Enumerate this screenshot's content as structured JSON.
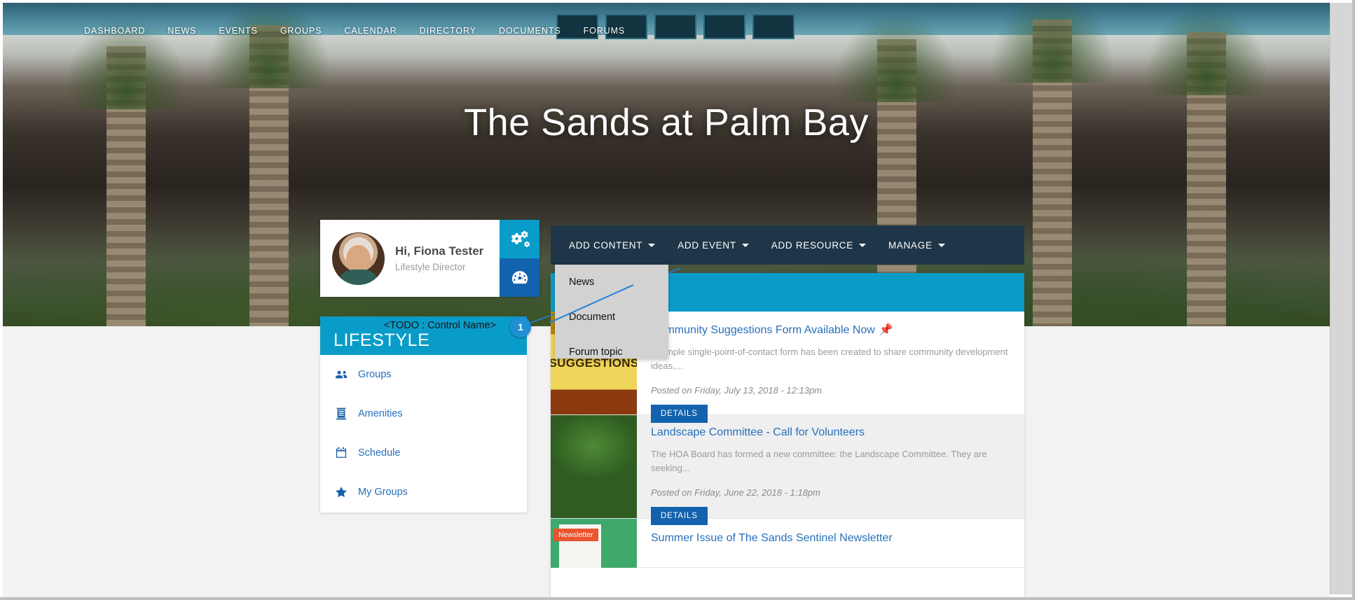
{
  "site": {
    "title": "The Sands at Palm Bay"
  },
  "top_nav": {
    "items": [
      {
        "label": "DASHBOARD"
      },
      {
        "label": "NEWS"
      },
      {
        "label": "EVENTS"
      },
      {
        "label": "GROUPS"
      },
      {
        "label": "CALENDAR"
      },
      {
        "label": "DIRECTORY"
      },
      {
        "label": "DOCUMENTS"
      },
      {
        "label": "FORUMS"
      }
    ]
  },
  "profile": {
    "greeting": "Hi, Fiona Tester",
    "role": "Lifestyle Director",
    "settings_icon": "gears-icon",
    "dashboard_icon": "speedometer-icon"
  },
  "lifestyle": {
    "title": "LIFESTYLE",
    "todo_note": "<TODO : Control Name>",
    "badge": "1",
    "header_color": "#0a9cc8",
    "items": [
      {
        "label": "Groups",
        "icon": "users-group-icon"
      },
      {
        "label": "Amenities",
        "icon": "building-icon"
      },
      {
        "label": "Schedule",
        "icon": "calendar-icon"
      },
      {
        "label": "My Groups",
        "icon": "star-icon"
      }
    ]
  },
  "admin_toolbar": {
    "background": "#1e3648",
    "buttons": [
      {
        "label": "ADD CONTENT",
        "has_caret": true,
        "expanded": true
      },
      {
        "label": "ADD EVENT",
        "has_caret": true,
        "expanded": false
      },
      {
        "label": "ADD RESOURCE",
        "has_caret": true,
        "expanded": false
      },
      {
        "label": "MANAGE",
        "has_caret": true,
        "expanded": false
      }
    ]
  },
  "add_content_menu": {
    "items": [
      {
        "label": "News"
      },
      {
        "label": "Document"
      },
      {
        "label": "Forum topic"
      }
    ]
  },
  "news_widget": {
    "header_color": "#0a9cc8",
    "details_label": "DETAILS",
    "items": [
      {
        "title": "Community Suggestions Form Available Now",
        "pinned": true,
        "pin_icon": "pin-icon",
        "summary": "A simple single-point-of-contact form has been created to share community development ideas,...",
        "date": "Posted on Friday, July 13, 2018 - 12:13pm",
        "thumb": "suggestions-thumbnail",
        "thumb_text": "SUGGESTIONS"
      },
      {
        "title": "Landscape Committee - Call for Volunteers",
        "pinned": false,
        "summary": "The HOA Board has formed a new committee:  the Landscape Committee. They are seeking...",
        "date": "Posted on Friday, June 22, 2018 - 1:18pm",
        "thumb": "landscape-thumbnail",
        "thumb_text": ""
      },
      {
        "title": "Summer Issue of The Sands Sentinel Newsletter",
        "pinned": false,
        "summary": "",
        "date": "",
        "thumb": "newsletter-thumbnail",
        "thumb_text": "Newsletter"
      }
    ]
  }
}
